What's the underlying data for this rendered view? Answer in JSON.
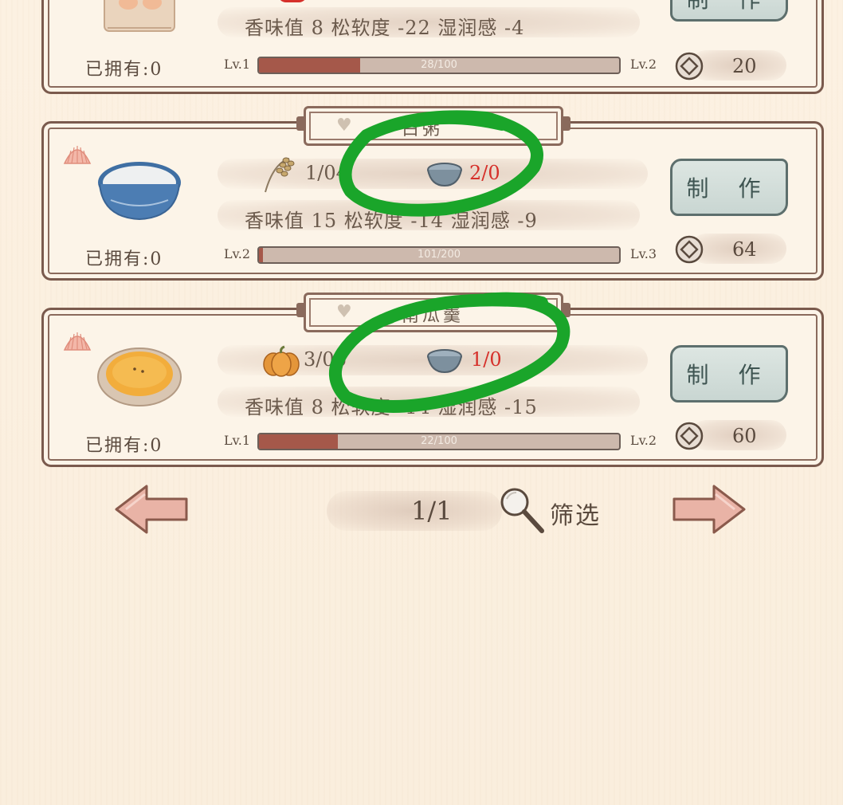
{
  "cards": [
    {
      "title": "",
      "stats": "香味值 8   松软度 -22  湿润感 -4",
      "owned": "已拥有:0",
      "lv_from": "Lv.1",
      "lv_to": "Lv.2",
      "progress_text": "28/100",
      "progress": 0.28,
      "price": "20",
      "make_label": "制 作",
      "ingredients": []
    },
    {
      "title": "白粥",
      "stats": "香味值 15   松软度 -14  湿润感 -9",
      "owned": "已拥有:0",
      "lv_from": "Lv.2",
      "lv_to": "Lv.3",
      "progress_text": "101/200",
      "progress": 0.01,
      "price": "64",
      "make_label": "制 作",
      "ingredients": [
        {
          "icon": "rice-stalk-icon",
          "count": "1/04"
        },
        {
          "icon": "bowl-icon",
          "count": "2/0"
        }
      ]
    },
    {
      "title": "南瓜羹",
      "stats": "香味值 8   松软度 -14  湿润感 -15",
      "owned": "已拥有:0",
      "lv_from": "Lv.1",
      "lv_to": "Lv.2",
      "progress_text": "22/100",
      "progress": 0.22,
      "price": "60",
      "make_label": "制 作",
      "ingredients": [
        {
          "icon": "pumpkin-icon",
          "count": "3/06"
        },
        {
          "icon": "bowl-icon",
          "count": "1/0"
        }
      ]
    }
  ],
  "pager": {
    "page": "1/1",
    "filter_label": "筛选"
  },
  "colors": {
    "background": "#fbefdf",
    "frame": "#7a5a4d",
    "progress_fill": "#a5584a",
    "make_button": "#d3ddd9",
    "shortage_red": "#d6302a",
    "annotation_green": "#1aa52a"
  }
}
